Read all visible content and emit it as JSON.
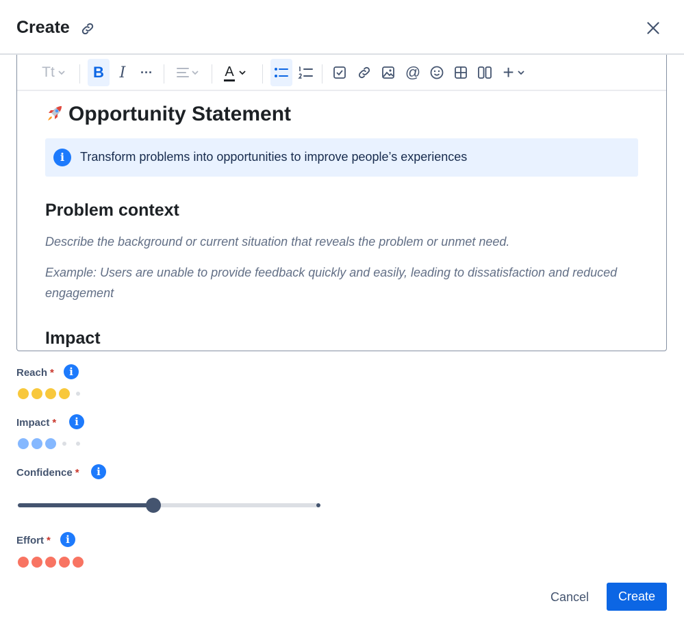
{
  "header": {
    "title": "Create",
    "link_icon": "link-icon",
    "close_icon": "close-icon"
  },
  "toolbar": {
    "items": [
      {
        "name": "text-style",
        "label": "Tt"
      },
      {
        "name": "bold",
        "label": "B"
      },
      {
        "name": "italic",
        "label": "I"
      },
      {
        "name": "more-formatting",
        "label": "···"
      },
      {
        "name": "alignment",
        "icon": "align-icon"
      },
      {
        "name": "text-color",
        "label": "A"
      },
      {
        "name": "bullet-list",
        "icon": "bullet-list-icon"
      },
      {
        "name": "numbered-list",
        "icon": "numbered-list-icon"
      },
      {
        "name": "action-item",
        "icon": "checkbox-icon"
      },
      {
        "name": "link",
        "icon": "link-icon"
      },
      {
        "name": "image",
        "icon": "image-icon"
      },
      {
        "name": "mention",
        "label": "@"
      },
      {
        "name": "emoji",
        "icon": "emoji-icon"
      },
      {
        "name": "table",
        "icon": "table-icon"
      },
      {
        "name": "layouts",
        "icon": "columns-icon"
      },
      {
        "name": "insert",
        "label": "+"
      }
    ]
  },
  "editor": {
    "heading": "Opportunity Statement",
    "heading_icon": "rocket-icon",
    "info_panel": {
      "icon": "info-icon",
      "text": "Transform problems into opportunities to improve people’s experiences"
    },
    "sections": [
      {
        "title": "Problem context",
        "placeholders": [
          "Describe the background or current situation that reveals the problem or unmet need.",
          "Example: Users are unable to provide feedback quickly and easily, leading to dissatisfaction and reduced engagement"
        ]
      },
      {
        "title": "Impact"
      }
    ]
  },
  "fields": {
    "reach": {
      "label": "Reach",
      "required": "*",
      "rating": 4,
      "max": 5,
      "color": "#f8c83c"
    },
    "impact": {
      "label": "Impact",
      "required": "*",
      "rating": 3,
      "max": 5,
      "color": "#85b8ff"
    },
    "confidence": {
      "label": "Confidence",
      "required": "*",
      "value_fraction": 0.45
    },
    "effort": {
      "label": "Effort",
      "required": "*",
      "rating": 5,
      "max": 5,
      "color": "#f87462"
    }
  },
  "footer": {
    "cancel_label": "Cancel",
    "create_label": "Create"
  },
  "colors": {
    "accent": "#0c66e4",
    "info": "#1d7afc",
    "required": "#c9372c"
  }
}
